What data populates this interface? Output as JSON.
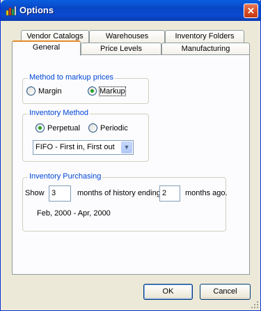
{
  "window": {
    "title": "Options"
  },
  "tabs_row1": [
    "Vendor Catalogs",
    "Warehouses",
    "Inventory Folders"
  ],
  "tabs_row2": [
    "General",
    "Price Levels",
    "Manufacturing"
  ],
  "markup": {
    "group_label": "Method to markup prices",
    "option_margin": "Margin",
    "option_markup": "Markup",
    "selected": "Markup"
  },
  "inventory_method": {
    "group_label": "Inventory Method",
    "option_perpetual": "Perpetual",
    "option_periodic": "Periodic",
    "selected": "Perpetual",
    "costing_value": "FIFO - First in, First out"
  },
  "purchasing": {
    "group_label": "Inventory Purchasing",
    "show_label": "Show",
    "months_history": "3",
    "months_history_label": "months of history ending",
    "months_ago": "2",
    "months_ago_label": "months ago.",
    "date_range": "Feb, 2000 - Apr, 2000"
  },
  "buttons": {
    "ok": "OK",
    "cancel": "Cancel"
  }
}
